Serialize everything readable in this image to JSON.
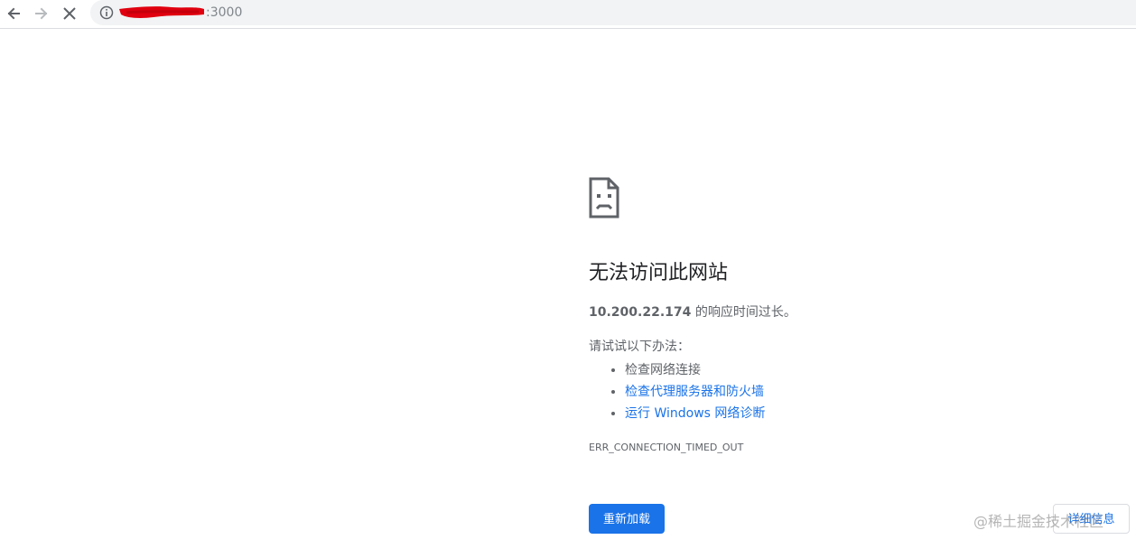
{
  "browser": {
    "url_visible_suffix": ":3000",
    "back_icon": "back-arrow-icon",
    "forward_icon": "forward-arrow-icon",
    "stop_icon": "close-icon",
    "site_info_icon": "info-icon"
  },
  "error": {
    "title": "无法访问此网站",
    "host": "10.200.22.174",
    "summary_suffix": " 的响应时间过长。",
    "try_label": "请试试以下办法：",
    "suggestions": [
      {
        "text": "检查网络连接",
        "link": false
      },
      {
        "text": "检查代理服务器和防火墙",
        "link": true
      },
      {
        "text": "运行 Windows 网络诊断",
        "link": true
      }
    ],
    "code": "ERR_CONNECTION_TIMED_OUT",
    "reload_label": "重新加载",
    "details_label": "详细信息"
  },
  "watermark": {
    "text": "@稀土掘金技术社区"
  },
  "colors": {
    "accent": "#1a73e8",
    "text_secondary": "#5f6368",
    "text_primary": "#202124",
    "redaction": "#e0000f"
  }
}
